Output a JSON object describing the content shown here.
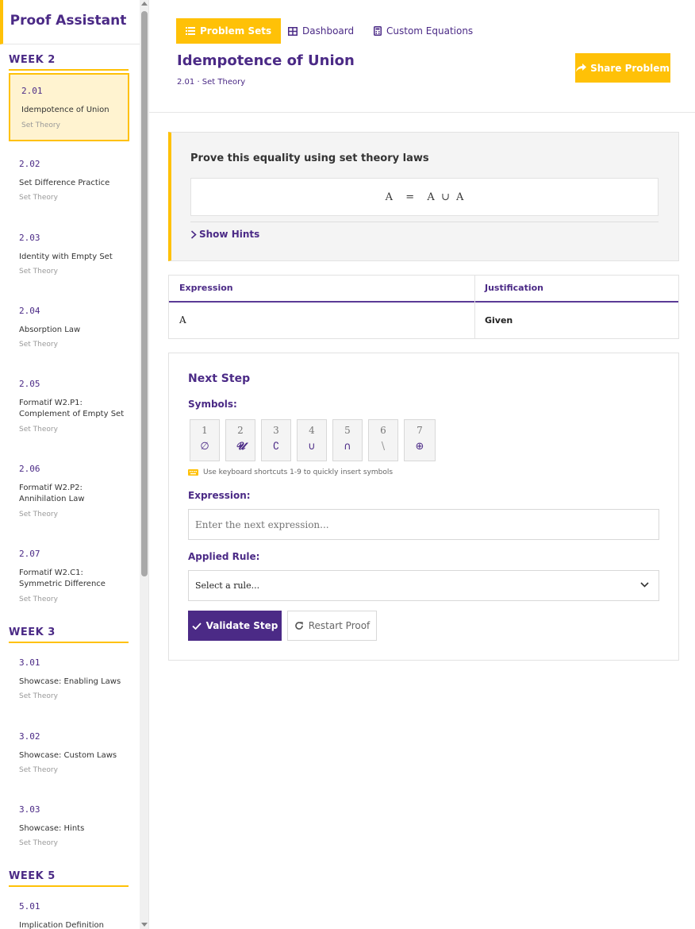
{
  "sidebar": {
    "title": "Proof Assistant",
    "weeks": [
      {
        "label": "WEEK 2",
        "items": [
          {
            "num": "2.01",
            "title": "Idempotence of Union",
            "topic": "Set Theory",
            "active": true
          },
          {
            "num": "2.02",
            "title": "Set Difference Practice",
            "topic": "Set Theory"
          },
          {
            "num": "2.03",
            "title": "Identity with Empty Set",
            "topic": "Set Theory"
          },
          {
            "num": "2.04",
            "title": "Absorption Law",
            "topic": "Set Theory"
          },
          {
            "num": "2.05",
            "title": "Formatif W2.P1: Complement of Empty Set",
            "topic": "Set Theory"
          },
          {
            "num": "2.06",
            "title": "Formatif W2.P2: Annihilation Law",
            "topic": "Set Theory"
          },
          {
            "num": "2.07",
            "title": "Formatif W2.C1: Symmetric Difference",
            "topic": "Set Theory"
          }
        ]
      },
      {
        "label": "WEEK 3",
        "items": [
          {
            "num": "3.01",
            "title": "Showcase: Enabling Laws",
            "topic": "Set Theory"
          },
          {
            "num": "3.02",
            "title": "Showcase: Custom Laws",
            "topic": "Set Theory"
          },
          {
            "num": "3.03",
            "title": "Showcase: Hints",
            "topic": "Set Theory"
          }
        ]
      },
      {
        "label": "WEEK 5",
        "items": [
          {
            "num": "5.01",
            "title": "Implication Definition",
            "topic": ""
          }
        ]
      }
    ]
  },
  "nav": {
    "problem_sets": "Problem Sets",
    "dashboard": "Dashboard",
    "custom_equations": "Custom Equations"
  },
  "problem": {
    "title": "Idempotence of Union",
    "breadcrumb": "2.01 · Set Theory",
    "share_label": "Share Problem",
    "prompt": "Prove this equality using set theory laws",
    "equation": "A  =  A ∪ A",
    "hints_label": "Show Hints"
  },
  "proof_table": {
    "headers": [
      "Expression",
      "Justification"
    ],
    "rows": [
      {
        "expression": "A",
        "justification": "Given"
      }
    ]
  },
  "next_step": {
    "title": "Next Step",
    "symbols_label": "Symbols:",
    "symbols": [
      {
        "key": "1",
        "glyph": "∅"
      },
      {
        "key": "2",
        "glyph": "𝓤"
      },
      {
        "key": "3",
        "glyph": "∁"
      },
      {
        "key": "4",
        "glyph": "∪"
      },
      {
        "key": "5",
        "glyph": "∩"
      },
      {
        "key": "6",
        "glyph": "\\"
      },
      {
        "key": "7",
        "glyph": "⊕"
      }
    ],
    "keyboard_tip": "Use keyboard shortcuts 1-9 to quickly insert symbols",
    "expression_label": "Expression:",
    "expression_placeholder": "Enter the next expression...",
    "rule_label": "Applied Rule:",
    "rule_selected": "Select a rule...",
    "validate_label": "Validate Step",
    "restart_label": "Restart Proof"
  },
  "colors": {
    "brand_purple": "#4b2a86",
    "accent_yellow": "#ffc107"
  }
}
